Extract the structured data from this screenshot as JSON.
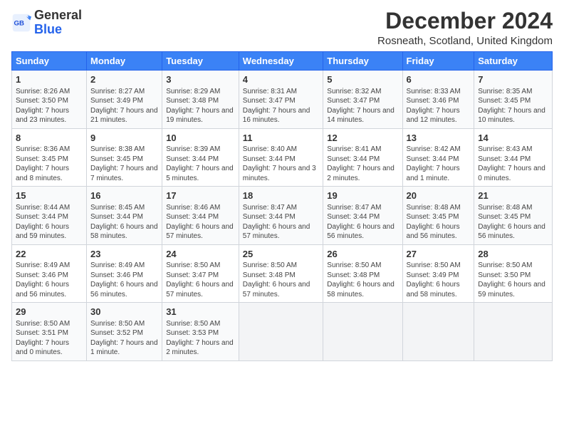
{
  "logo": {
    "text_general": "General",
    "text_blue": "Blue"
  },
  "title": "December 2024",
  "location": "Rosneath, Scotland, United Kingdom",
  "headers": [
    "Sunday",
    "Monday",
    "Tuesday",
    "Wednesday",
    "Thursday",
    "Friday",
    "Saturday"
  ],
  "weeks": [
    [
      {
        "day": "1",
        "sunrise": "Sunrise: 8:26 AM",
        "sunset": "Sunset: 3:50 PM",
        "daylight": "Daylight: 7 hours and 23 minutes."
      },
      {
        "day": "2",
        "sunrise": "Sunrise: 8:27 AM",
        "sunset": "Sunset: 3:49 PM",
        "daylight": "Daylight: 7 hours and 21 minutes."
      },
      {
        "day": "3",
        "sunrise": "Sunrise: 8:29 AM",
        "sunset": "Sunset: 3:48 PM",
        "daylight": "Daylight: 7 hours and 19 minutes."
      },
      {
        "day": "4",
        "sunrise": "Sunrise: 8:31 AM",
        "sunset": "Sunset: 3:47 PM",
        "daylight": "Daylight: 7 hours and 16 minutes."
      },
      {
        "day": "5",
        "sunrise": "Sunrise: 8:32 AM",
        "sunset": "Sunset: 3:47 PM",
        "daylight": "Daylight: 7 hours and 14 minutes."
      },
      {
        "day": "6",
        "sunrise": "Sunrise: 8:33 AM",
        "sunset": "Sunset: 3:46 PM",
        "daylight": "Daylight: 7 hours and 12 minutes."
      },
      {
        "day": "7",
        "sunrise": "Sunrise: 8:35 AM",
        "sunset": "Sunset: 3:45 PM",
        "daylight": "Daylight: 7 hours and 10 minutes."
      }
    ],
    [
      {
        "day": "8",
        "sunrise": "Sunrise: 8:36 AM",
        "sunset": "Sunset: 3:45 PM",
        "daylight": "Daylight: 7 hours and 8 minutes."
      },
      {
        "day": "9",
        "sunrise": "Sunrise: 8:38 AM",
        "sunset": "Sunset: 3:45 PM",
        "daylight": "Daylight: 7 hours and 7 minutes."
      },
      {
        "day": "10",
        "sunrise": "Sunrise: 8:39 AM",
        "sunset": "Sunset: 3:44 PM",
        "daylight": "Daylight: 7 hours and 5 minutes."
      },
      {
        "day": "11",
        "sunrise": "Sunrise: 8:40 AM",
        "sunset": "Sunset: 3:44 PM",
        "daylight": "Daylight: 7 hours and 3 minutes."
      },
      {
        "day": "12",
        "sunrise": "Sunrise: 8:41 AM",
        "sunset": "Sunset: 3:44 PM",
        "daylight": "Daylight: 7 hours and 2 minutes."
      },
      {
        "day": "13",
        "sunrise": "Sunrise: 8:42 AM",
        "sunset": "Sunset: 3:44 PM",
        "daylight": "Daylight: 7 hours and 1 minute."
      },
      {
        "day": "14",
        "sunrise": "Sunrise: 8:43 AM",
        "sunset": "Sunset: 3:44 PM",
        "daylight": "Daylight: 7 hours and 0 minutes."
      }
    ],
    [
      {
        "day": "15",
        "sunrise": "Sunrise: 8:44 AM",
        "sunset": "Sunset: 3:44 PM",
        "daylight": "Daylight: 6 hours and 59 minutes."
      },
      {
        "day": "16",
        "sunrise": "Sunrise: 8:45 AM",
        "sunset": "Sunset: 3:44 PM",
        "daylight": "Daylight: 6 hours and 58 minutes."
      },
      {
        "day": "17",
        "sunrise": "Sunrise: 8:46 AM",
        "sunset": "Sunset: 3:44 PM",
        "daylight": "Daylight: 6 hours and 57 minutes."
      },
      {
        "day": "18",
        "sunrise": "Sunrise: 8:47 AM",
        "sunset": "Sunset: 3:44 PM",
        "daylight": "Daylight: 6 hours and 57 minutes."
      },
      {
        "day": "19",
        "sunrise": "Sunrise: 8:47 AM",
        "sunset": "Sunset: 3:44 PM",
        "daylight": "Daylight: 6 hours and 56 minutes."
      },
      {
        "day": "20",
        "sunrise": "Sunrise: 8:48 AM",
        "sunset": "Sunset: 3:45 PM",
        "daylight": "Daylight: 6 hours and 56 minutes."
      },
      {
        "day": "21",
        "sunrise": "Sunrise: 8:48 AM",
        "sunset": "Sunset: 3:45 PM",
        "daylight": "Daylight: 6 hours and 56 minutes."
      }
    ],
    [
      {
        "day": "22",
        "sunrise": "Sunrise: 8:49 AM",
        "sunset": "Sunset: 3:46 PM",
        "daylight": "Daylight: 6 hours and 56 minutes."
      },
      {
        "day": "23",
        "sunrise": "Sunrise: 8:49 AM",
        "sunset": "Sunset: 3:46 PM",
        "daylight": "Daylight: 6 hours and 56 minutes."
      },
      {
        "day": "24",
        "sunrise": "Sunrise: 8:50 AM",
        "sunset": "Sunset: 3:47 PM",
        "daylight": "Daylight: 6 hours and 57 minutes."
      },
      {
        "day": "25",
        "sunrise": "Sunrise: 8:50 AM",
        "sunset": "Sunset: 3:48 PM",
        "daylight": "Daylight: 6 hours and 57 minutes."
      },
      {
        "day": "26",
        "sunrise": "Sunrise: 8:50 AM",
        "sunset": "Sunset: 3:48 PM",
        "daylight": "Daylight: 6 hours and 58 minutes."
      },
      {
        "day": "27",
        "sunrise": "Sunrise: 8:50 AM",
        "sunset": "Sunset: 3:49 PM",
        "daylight": "Daylight: 6 hours and 58 minutes."
      },
      {
        "day": "28",
        "sunrise": "Sunrise: 8:50 AM",
        "sunset": "Sunset: 3:50 PM",
        "daylight": "Daylight: 6 hours and 59 minutes."
      }
    ],
    [
      {
        "day": "29",
        "sunrise": "Sunrise: 8:50 AM",
        "sunset": "Sunset: 3:51 PM",
        "daylight": "Daylight: 7 hours and 0 minutes."
      },
      {
        "day": "30",
        "sunrise": "Sunrise: 8:50 AM",
        "sunset": "Sunset: 3:52 PM",
        "daylight": "Daylight: 7 hours and 1 minute."
      },
      {
        "day": "31",
        "sunrise": "Sunrise: 8:50 AM",
        "sunset": "Sunset: 3:53 PM",
        "daylight": "Daylight: 7 hours and 2 minutes."
      },
      null,
      null,
      null,
      null
    ]
  ]
}
